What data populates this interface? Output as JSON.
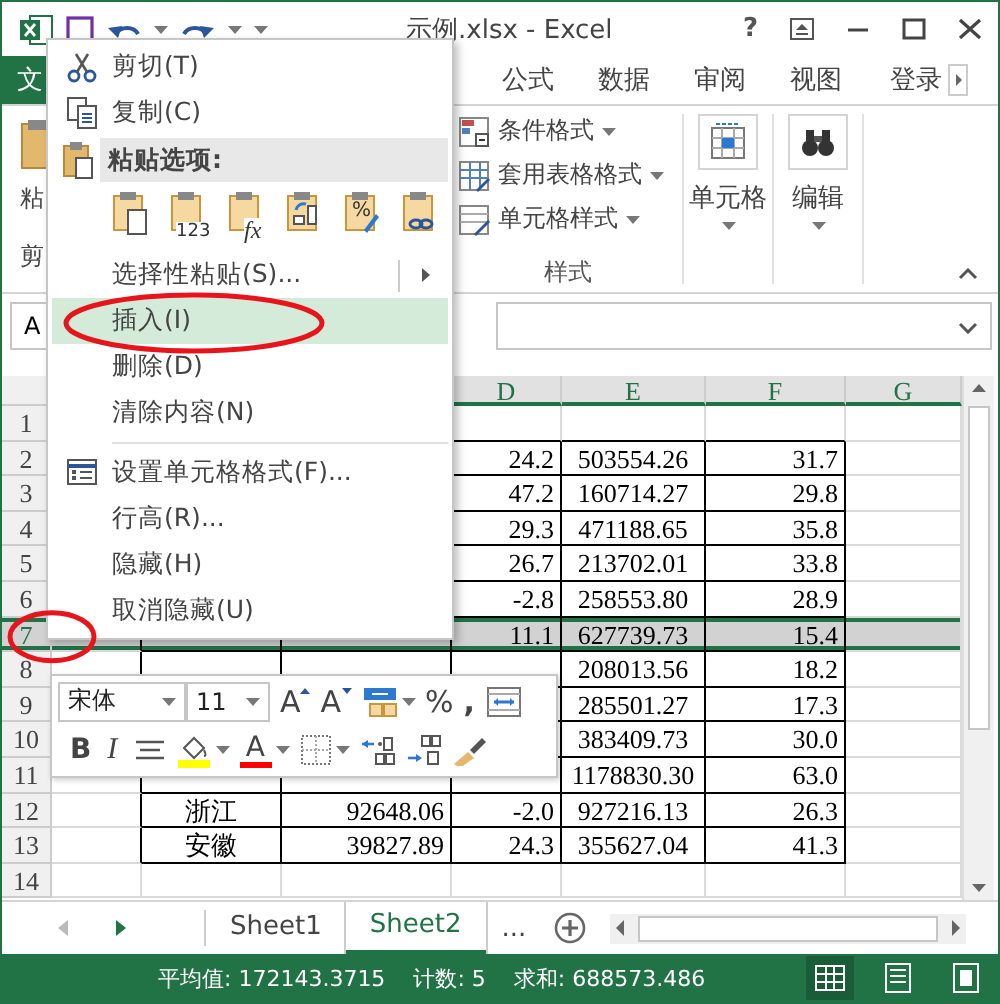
{
  "title_bar": {
    "title": "示例.xlsx - Excel",
    "help": "?"
  },
  "ribbon": {
    "file_tab": {
      "label": "文"
    },
    "tabs": [
      {
        "label": "公式",
        "selected": false
      },
      {
        "label": "数据",
        "selected": false
      },
      {
        "label": "审阅",
        "selected": false
      },
      {
        "label": "视图",
        "selected": false
      }
    ],
    "account": "登录",
    "clipboard": {
      "button": "粘",
      "label": "剪"
    },
    "styles": {
      "items": [
        "条件格式",
        "套用表格格式",
        "单元格样式"
      ],
      "label": "样式"
    },
    "cells_button": "单元格",
    "editing_button": "编辑"
  },
  "formula_bar": {
    "name_box": "A"
  },
  "sheet": {
    "columns": [
      null,
      null,
      null,
      "D",
      "E",
      "F",
      "G"
    ],
    "rows": [
      {
        "header": "1",
        "selected": false,
        "cells": [
          null,
          null,
          null,
          null,
          null,
          null,
          null
        ]
      },
      {
        "header": "2",
        "selected": false,
        "cells": [
          null,
          null,
          null,
          "24.2",
          "503554.26",
          "31.7",
          null
        ]
      },
      {
        "header": "3",
        "selected": false,
        "cells": [
          null,
          null,
          null,
          "47.2",
          "160714.27",
          "29.8",
          null
        ]
      },
      {
        "header": "4",
        "selected": false,
        "cells": [
          null,
          null,
          null,
          "29.3",
          "471188.65",
          "35.8",
          null
        ]
      },
      {
        "header": "5",
        "selected": false,
        "cells": [
          null,
          null,
          null,
          "26.7",
          "213702.01",
          "33.8",
          null
        ]
      },
      {
        "header": "6",
        "selected": false,
        "cells": [
          null,
          null,
          null,
          "-2.8",
          "258553.80",
          "28.9",
          null
        ]
      },
      {
        "header": "7",
        "selected": true,
        "circled": true,
        "cells": [
          null,
          null,
          null,
          "11.1",
          "627739.73",
          "15.4",
          null
        ]
      },
      {
        "header": "8",
        "selected": false,
        "cells": [
          null,
          null,
          null,
          null,
          "208013.56",
          "18.2",
          null
        ]
      },
      {
        "header": "9",
        "selected": false,
        "cells": [
          null,
          null,
          null,
          null,
          "285501.27",
          "17.3",
          null
        ]
      },
      {
        "header": "10",
        "selected": false,
        "cells": [
          null,
          null,
          null,
          null,
          "383409.73",
          "30.0",
          null
        ]
      },
      {
        "header": "11",
        "selected": false,
        "cells": [
          null,
          null,
          null,
          null,
          "1178830.30",
          "63.0",
          null
        ]
      },
      {
        "header": "12",
        "selected": false,
        "cells": [
          null,
          "浙江",
          "92648.06",
          "-2.0",
          "927216.13",
          "26.3",
          null
        ]
      },
      {
        "header": "13",
        "selected": false,
        "cells": [
          null,
          "安徽",
          "39827.89",
          "24.3",
          "355627.04",
          "41.3",
          null
        ]
      },
      {
        "header": "14",
        "selected": false,
        "cells": [
          null,
          null,
          null,
          null,
          null,
          null,
          null
        ]
      }
    ]
  },
  "context_menu": {
    "items": [
      {
        "kind": "item",
        "label": "剪切(T)",
        "highlighted": false,
        "submenu": false,
        "circled": false
      },
      {
        "kind": "item",
        "label": "复制(C)",
        "highlighted": false,
        "submenu": false,
        "circled": false
      },
      {
        "kind": "header",
        "label": "粘贴选项:"
      },
      {
        "kind": "paste_options",
        "options": [
          {
            "kind": "paste"
          },
          {
            "kind": "values",
            "badge": "123"
          },
          {
            "kind": "formulas",
            "badge": "fx"
          },
          {
            "kind": "transpose"
          },
          {
            "kind": "formatting",
            "badge": "%"
          },
          {
            "kind": "link"
          }
        ]
      },
      {
        "kind": "item",
        "label": "选择性粘贴(S)...",
        "highlighted": false,
        "submenu": true,
        "circled": false
      },
      {
        "kind": "item",
        "label": "插入(I)",
        "highlighted": true,
        "submenu": false,
        "circled": true
      },
      {
        "kind": "item",
        "label": "删除(D)",
        "highlighted": false,
        "submenu": false,
        "circled": false
      },
      {
        "kind": "item",
        "label": "清除内容(N)",
        "highlighted": false,
        "submenu": false,
        "circled": false
      },
      {
        "kind": "separator"
      },
      {
        "kind": "item",
        "label": "设置单元格格式(F)...",
        "highlighted": false,
        "submenu": false,
        "circled": false
      },
      {
        "kind": "item",
        "label": "行高(R)...",
        "highlighted": false,
        "submenu": false,
        "circled": false
      },
      {
        "kind": "item",
        "label": "隐藏(H)",
        "highlighted": false,
        "submenu": false,
        "circled": false
      },
      {
        "kind": "item",
        "label": "取消隐藏(U)",
        "highlighted": false,
        "submenu": false,
        "circled": false
      }
    ]
  },
  "mini_toolbar": {
    "font": "宋体",
    "size": "11",
    "row1": [
      {
        "kind": "grow_font",
        "label": "A"
      },
      {
        "kind": "shrink_font",
        "label": "A"
      },
      {
        "kind": "number_format"
      },
      {
        "kind": "percent",
        "label": "%"
      },
      {
        "kind": "comma",
        "label": ","
      },
      {
        "kind": "wrap"
      }
    ],
    "row2": [
      {
        "kind": "bold",
        "label": "B"
      },
      {
        "kind": "italic",
        "label": "I"
      },
      {
        "kind": "align"
      },
      {
        "kind": "fill_color",
        "color": "#ffff00"
      },
      {
        "kind": "font_color",
        "label": "A",
        "color": "#ff0000"
      },
      {
        "kind": "borders"
      },
      {
        "kind": "decrease_decimal"
      },
      {
        "kind": "increase_decimal"
      },
      {
        "kind": "format_painter"
      }
    ]
  },
  "sheet_tabs": {
    "tabs": [
      {
        "label": "Sheet1",
        "selected": false
      },
      {
        "label": "Sheet2",
        "selected": true
      }
    ],
    "more": "..."
  },
  "status_bar": {
    "items": [
      "平均值: 172143.3715",
      "计数: 5",
      "求和: 688573.486"
    ],
    "views": [
      {
        "kind": "normal",
        "selected": true
      },
      {
        "kind": "page_layout",
        "selected": false
      },
      {
        "kind": "page_break",
        "selected": false
      }
    ]
  }
}
